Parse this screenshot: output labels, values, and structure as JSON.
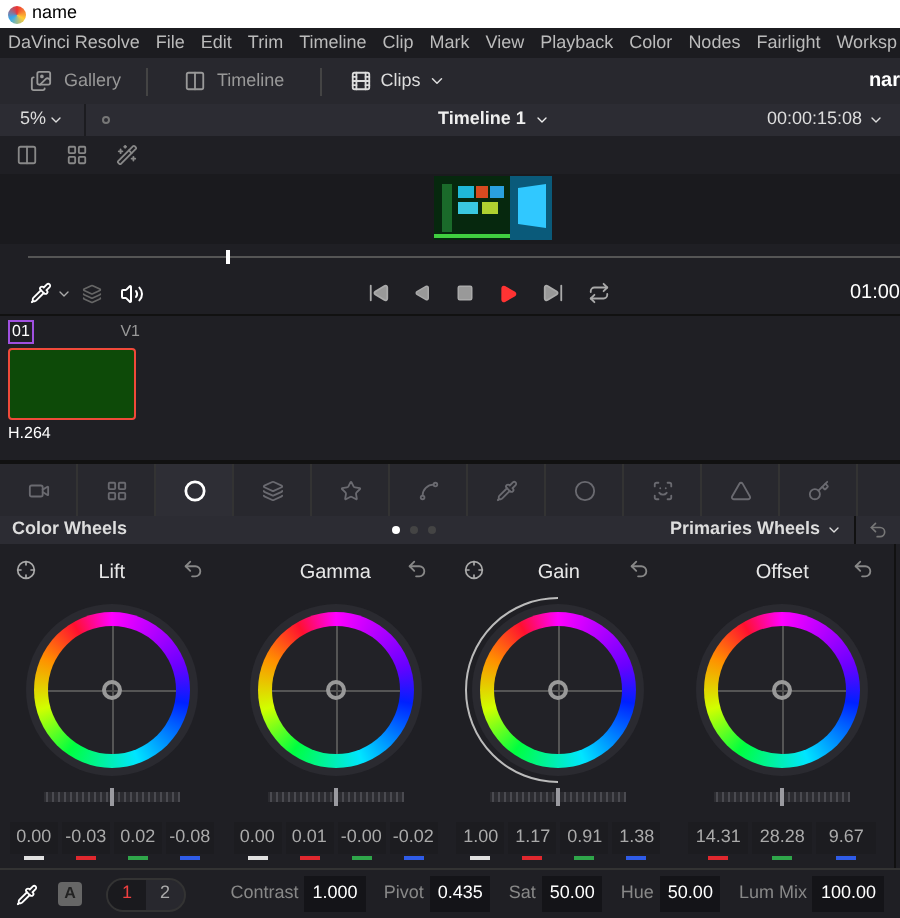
{
  "window": {
    "title": "name"
  },
  "menu": [
    "DaVinci Resolve",
    "File",
    "Edit",
    "Trim",
    "Timeline",
    "Clip",
    "Mark",
    "View",
    "Playback",
    "Color",
    "Nodes",
    "Fairlight",
    "Worksp"
  ],
  "toolbar": {
    "gallery": "Gallery",
    "timeline": "Timeline",
    "clips": "Clips",
    "project": "nar"
  },
  "timeline_bar": {
    "zoom": "5%",
    "name": "Timeline 1",
    "timecode": "00:00:15:08"
  },
  "playhead": {
    "level": 0.25
  },
  "transport": {
    "timecode": "01:00"
  },
  "clip": {
    "number": "01",
    "track": "V1",
    "codec": "H.264",
    "selected": true
  },
  "tools": [
    {
      "selected": false
    },
    {
      "selected": false
    },
    {
      "selected": true
    },
    {
      "selected": false
    },
    {
      "selected": false
    },
    {
      "selected": false
    },
    {
      "selected": false
    },
    {
      "selected": false
    },
    {
      "selected": false
    },
    {
      "selected": false
    },
    {
      "selected": false
    }
  ],
  "panel": {
    "title": "Color Wheels",
    "pages": [
      {
        "selected": true
      },
      {
        "selected": false
      },
      {
        "selected": false
      }
    ],
    "mode": "Primaries Wheels"
  },
  "wheels": [
    {
      "label": "Lift",
      "picker": true,
      "arc": false,
      "level": 0.5,
      "values": [
        {
          "text": "0.00",
          "color": "#e0e0e0"
        },
        {
          "text": "-0.03",
          "color": "#e0282e"
        },
        {
          "text": "0.02",
          "color": "#2fa64a"
        },
        {
          "text": "-0.08",
          "color": "#2f5ce8"
        }
      ]
    },
    {
      "label": "Gamma",
      "picker": false,
      "arc": false,
      "level": 0.5,
      "values": [
        {
          "text": "0.00",
          "color": "#e0e0e0"
        },
        {
          "text": "0.01",
          "color": "#e0282e"
        },
        {
          "text": "-0.00",
          "color": "#2fa64a"
        },
        {
          "text": "-0.02",
          "color": "#2f5ce8"
        }
      ]
    },
    {
      "label": "Gain",
      "picker": true,
      "arc": true,
      "level": 0.5,
      "values": [
        {
          "text": "1.00",
          "color": "#e0e0e0"
        },
        {
          "text": "1.17",
          "color": "#e0282e"
        },
        {
          "text": "0.91",
          "color": "#2fa64a"
        },
        {
          "text": "1.38",
          "color": "#2f5ce8"
        }
      ]
    },
    {
      "label": "Offset",
      "picker": false,
      "arc": false,
      "level": 0.5,
      "values": [
        {
          "text": "14.31",
          "color": "#e0282e"
        },
        {
          "text": "28.28",
          "color": "#2fa64a"
        },
        {
          "text": "9.67",
          "color": "#2f5ce8"
        }
      ]
    }
  ],
  "bottom": {
    "auto": "A",
    "pages": [
      {
        "label": "1",
        "selected": true
      },
      {
        "label": "2",
        "selected": false
      }
    ],
    "fields": [
      {
        "label": "Contrast",
        "value": "1.000"
      },
      {
        "label": "Pivot",
        "value": "0.435"
      },
      {
        "label": "Sat",
        "value": "50.00"
      },
      {
        "label": "Hue",
        "value": "50.00"
      },
      {
        "label": "Lum Mix",
        "value": "100.00"
      }
    ]
  }
}
